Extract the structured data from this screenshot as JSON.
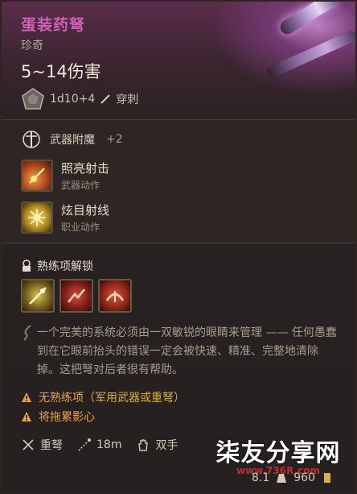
{
  "item": {
    "name": "蛋装药弩",
    "rarity": "珍奇",
    "damage": "5~14伤害",
    "dice": "1d10+4",
    "damage_type": "穿刺"
  },
  "enchant": {
    "label": "武器附魔",
    "bonus": "+2"
  },
  "actions": [
    {
      "title": "照亮射击",
      "subtitle": "武器动作",
      "icon": "illuminate-shot-icon"
    },
    {
      "title": "炫目射线",
      "subtitle": "职业动作",
      "icon": "dazzling-ray-icon"
    }
  ],
  "proficiency_unlock": {
    "label": "熟练项解锁",
    "icons": [
      "piercing-shot-icon",
      "mobile-shot-icon",
      "brace-icon"
    ]
  },
  "lore": "一个完美的系统必须由一双敏锐的眼睛来管理 —— 任何愚蠢到在它眼前抬头的错误一定会被快速、精准、完整地清除掉。这把弩对后者很有帮助。",
  "warnings": [
    {
      "text": "无熟练项",
      "paren": "（军用武器或重弩）"
    },
    {
      "text": "将拖累影心",
      "paren": ""
    }
  ],
  "properties": [
    {
      "label": "重弩",
      "icon": "crossbow-icon"
    },
    {
      "label": "18m",
      "icon": "range-icon"
    },
    {
      "label": "双手",
      "icon": "hand-icon"
    }
  ],
  "footer": {
    "weight": "8.1",
    "value": "960"
  },
  "watermark": {
    "main": "柒友分享网",
    "url": "www.736R.com"
  },
  "colors": {
    "item_name": "#d25fb6",
    "warning": "#e9a24a",
    "watermark_url": "#c92a2a"
  }
}
